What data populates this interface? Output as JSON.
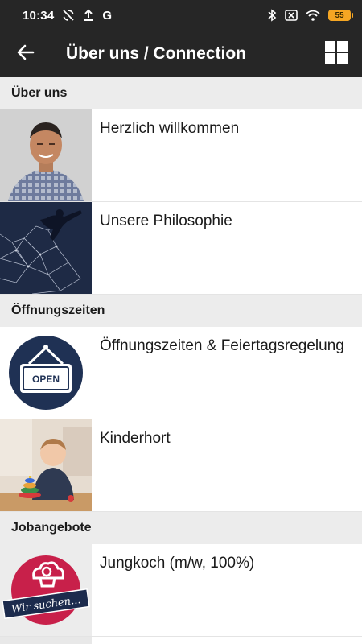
{
  "status_bar": {
    "time": "10:34",
    "left_icons": [
      "sync-off-icon",
      "upload-icon",
      "google-icon"
    ],
    "google_glyph": "G",
    "right_icons": [
      "bluetooth-icon",
      "no-sim-icon",
      "wifi-icon"
    ],
    "battery": "55"
  },
  "app_bar": {
    "title": "Über uns / Connection",
    "back_icon": "arrow-back-icon",
    "grid_icon": "grid-view-icon",
    "background": "#262626"
  },
  "sections": [
    {
      "header": "Über uns",
      "items": [
        {
          "label": "Herzlich willkommen",
          "thumbnail": "portrait-photo"
        },
        {
          "label": "Unsere Philosophie",
          "thumbnail": "dancer-network-photo"
        }
      ]
    },
    {
      "header": "Öffnungszeiten",
      "items": [
        {
          "label": "Öffnungszeiten & Feiertagsregelung",
          "thumbnail": "open-sign-icon",
          "sign_text": "OPEN"
        },
        {
          "label": "Kinderhort",
          "thumbnail": "child-playing-photo"
        }
      ]
    },
    {
      "header": "Jobangebote",
      "items": [
        {
          "label": "Jungkoch (m/w, 100%)",
          "thumbnail": "wir-suchen-badge",
          "badge_text": "Wir suchen..."
        }
      ]
    }
  ],
  "colors": {
    "section_header_bg": "#ececec",
    "open_sign_bg": "#1f3154",
    "badge_red": "#c8204a",
    "badge_navy": "#1c2b4d"
  }
}
